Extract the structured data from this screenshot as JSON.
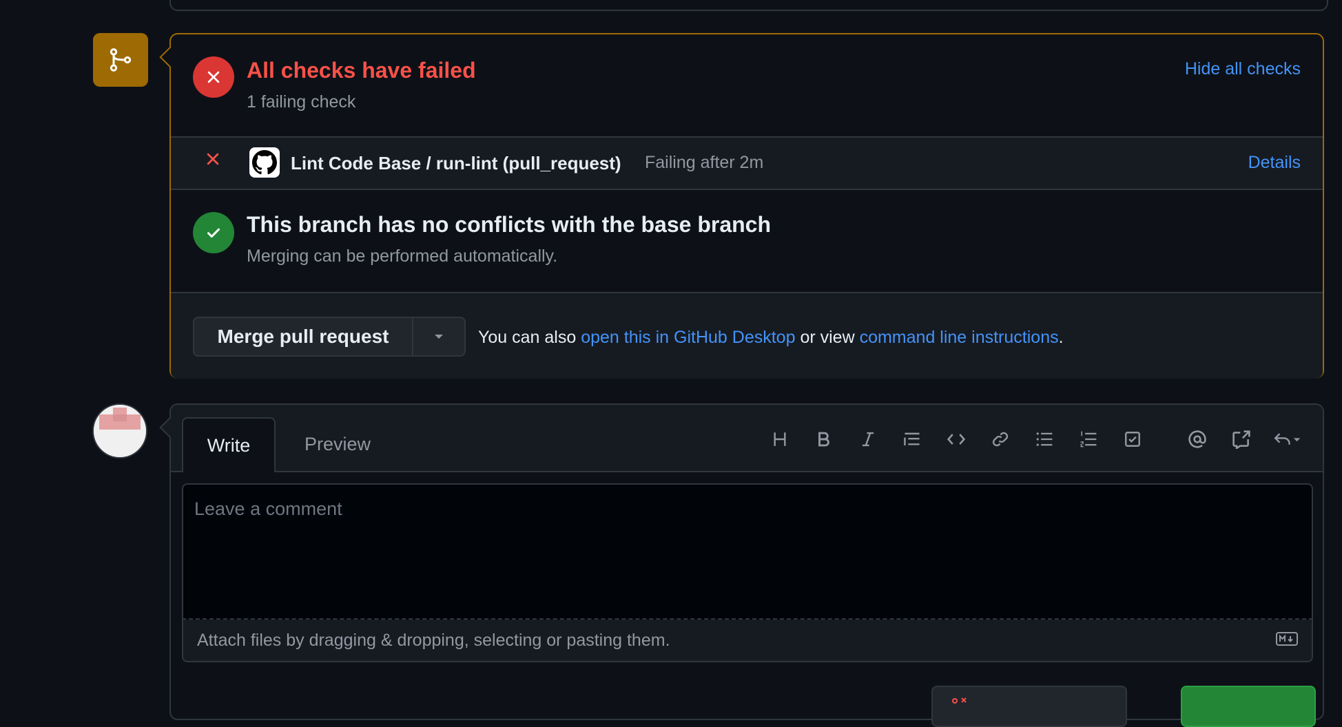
{
  "checks": {
    "title": "All checks have failed",
    "subtitle": "1 failing check",
    "hide_label": "Hide all checks"
  },
  "check_row": {
    "name": "Lint Code Base / run-lint (pull_request)",
    "status": "Failing after 2m",
    "details_label": "Details"
  },
  "conflicts": {
    "title": "This branch has no conflicts with the base branch",
    "subtitle": "Merging can be performed automatically."
  },
  "merge": {
    "button_label": "Merge pull request",
    "also_prefix": "You can also",
    "desktop_link": "open this in GitHub Desktop",
    "or_view": "or view",
    "cli_link": "command line instructions",
    "period": "."
  },
  "comment": {
    "tab_write": "Write",
    "tab_preview": "Preview",
    "placeholder": "Leave a comment",
    "attach_text": "Attach files by dragging & dropping, selecting or pasting them."
  },
  "toolbar_icons": [
    "heading-icon",
    "bold-icon",
    "italic-icon",
    "quote-icon",
    "code-icon",
    "link-icon",
    "unordered-list-icon",
    "ordered-list-icon",
    "task-list-icon",
    "mention-icon",
    "cross-reference-icon",
    "saved-replies-icon"
  ],
  "colors": {
    "background": "#0d1117",
    "warning_border": "#9e6a03",
    "danger": "#f85149",
    "success": "#238636",
    "link": "#4493f8"
  }
}
